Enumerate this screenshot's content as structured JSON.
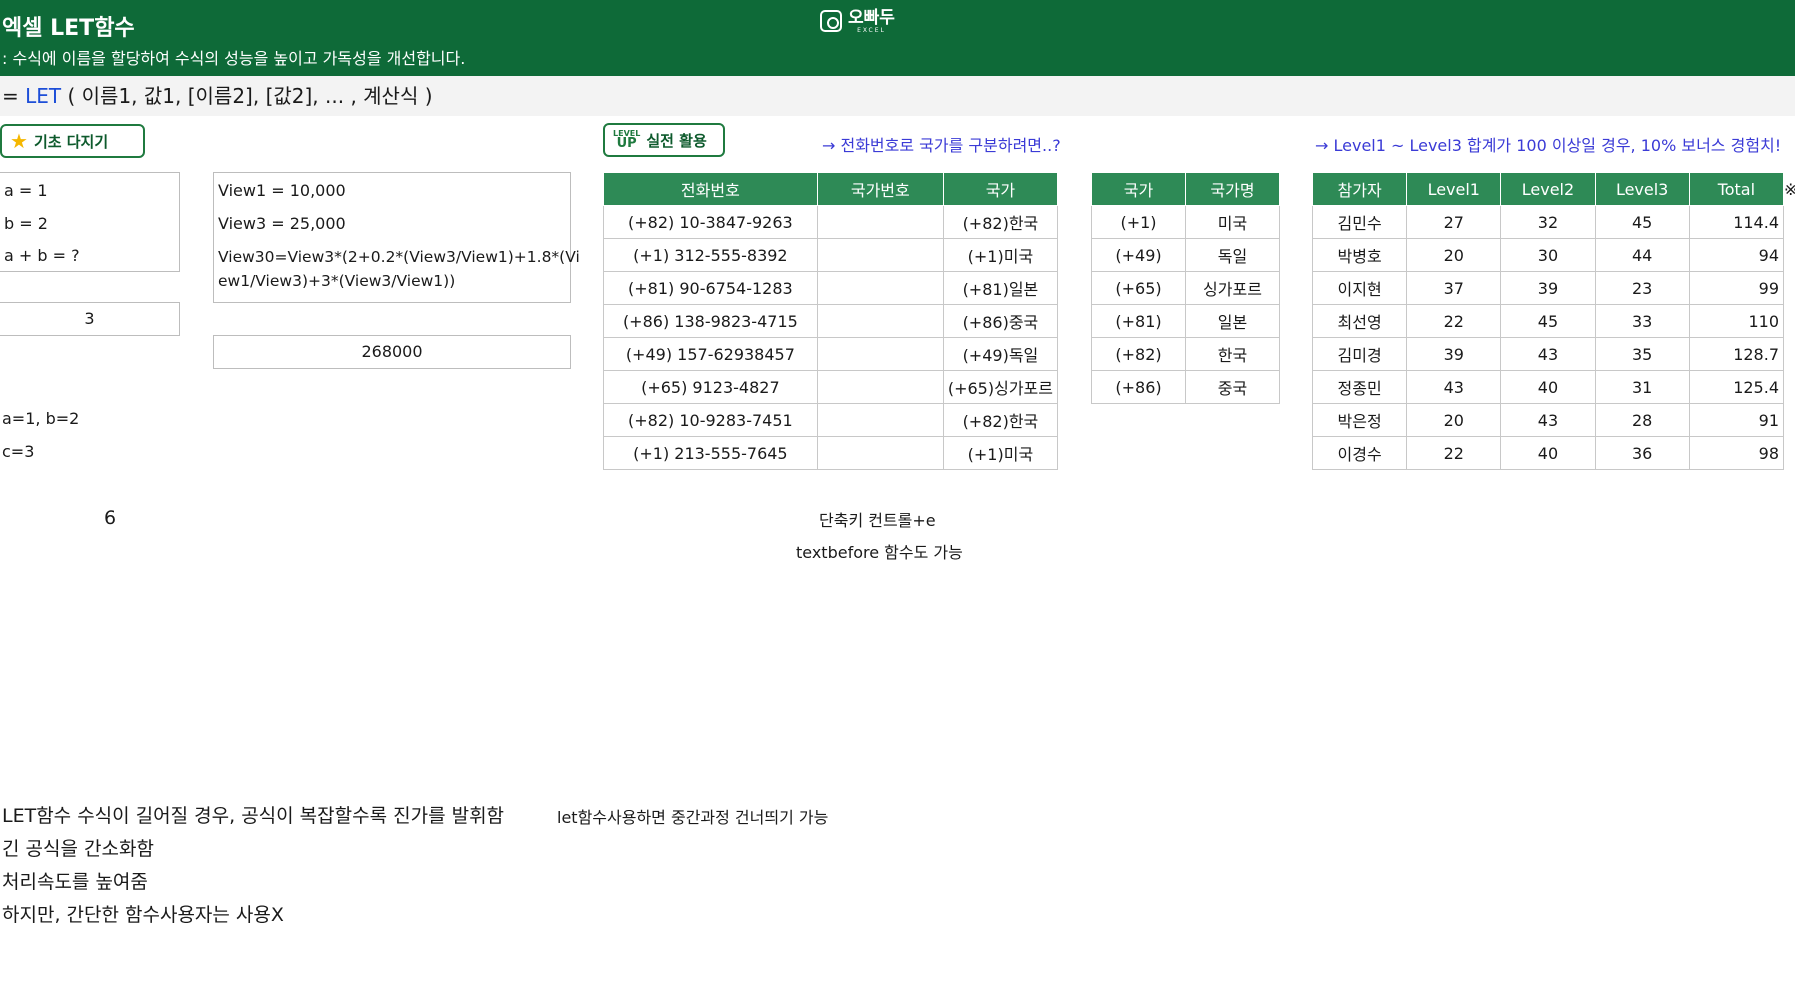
{
  "banner": {
    "title": "엑셀 LET함수",
    "description": ": 수식에 이름을 할당하여 수식의 성능을 높이고 가독성을 개선합니다.",
    "logo_text": "오빠두",
    "logo_sub": "EXCEL"
  },
  "syntax": {
    "prefix": "= ",
    "keyword": "LET",
    "rest": " ( 이름1, 값1, [이름2], [값2], ... , 계산식 )"
  },
  "badges": {
    "basic": "기초 다지기",
    "practical": "실전 활용",
    "level_small": "LEVEL",
    "level_big": "UP"
  },
  "notes": {
    "phone": "→ 전화번호로 국가를 구분하려면..?",
    "bonus": "→ Level1 ~ Level3 합계가 100 이상일 경우, 10% 보너스 경험치!",
    "bonus_mark": "※"
  },
  "basic_example": {
    "lines": [
      "a = 1",
      "b = 2",
      "a +  b = ?"
    ],
    "result": "3",
    "named": "a=1, b=2",
    "c": "c=3",
    "six": "6"
  },
  "view_example": {
    "lines": [
      "View1 = 10,000",
      "View3 = 25,000",
      "View30=View3*(2+0.2*(View3/View1)+1.8*(Vi",
      "ew1/View3)+3*(View3/View1))"
    ],
    "result": "268000"
  },
  "phone_table": {
    "headers": [
      "전화번호",
      "국가번호",
      "국가"
    ],
    "rows": [
      [
        "(+82) 10-3847-9263",
        "",
        "(+82)한국"
      ],
      [
        "(+1) 312-555-8392",
        "",
        "(+1)미국"
      ],
      [
        "(+81) 90-6754-1283",
        "",
        "(+81)일본"
      ],
      [
        "(+86) 138-9823-4715",
        "",
        "(+86)중국"
      ],
      [
        "(+49) 157-62938457",
        "",
        "(+49)독일"
      ],
      [
        "(+65) 9123-4827",
        "",
        "(+65)싱가포르"
      ],
      [
        "(+82) 10-9283-7451",
        "",
        "(+82)한국"
      ],
      [
        "(+1) 213-555-7645",
        "",
        "(+1)미국"
      ]
    ]
  },
  "country_table": {
    "headers": [
      "국가",
      "국가명"
    ],
    "rows": [
      [
        "(+1)",
        "미국"
      ],
      [
        "(+49)",
        "독일"
      ],
      [
        "(+65)",
        "싱가포르"
      ],
      [
        "(+81)",
        "일본"
      ],
      [
        "(+82)",
        "한국"
      ],
      [
        "(+86)",
        "중국"
      ]
    ]
  },
  "level_table": {
    "headers": [
      "참가자",
      "Level1",
      "Level2",
      "Level3",
      "Total"
    ],
    "rows": [
      [
        "김민수",
        "27",
        "32",
        "45",
        "114.4"
      ],
      [
        "박병호",
        "20",
        "30",
        "44",
        "94"
      ],
      [
        "이지현",
        "37",
        "39",
        "23",
        "99"
      ],
      [
        "최선영",
        "22",
        "45",
        "33",
        "110"
      ],
      [
        "김미경",
        "39",
        "43",
        "35",
        "128.7"
      ],
      [
        "정종민",
        "43",
        "40",
        "31",
        "125.4"
      ],
      [
        "박은정",
        "20",
        "43",
        "28",
        "91"
      ],
      [
        "이경수",
        "22",
        "40",
        "36",
        "98"
      ]
    ]
  },
  "tips": {
    "shortcut": "단축키 컨트롤+e",
    "textbefore": "textbefore 함수도 가능"
  },
  "summary": {
    "line1": "LET함수 수식이 길어질 경우, 공식이 복잡할수록 진가를 발휘함",
    "line1_side": "let함수사용하면 중간과정 건너띄기 가능",
    "line2": "긴 공식을 간소화함",
    "line3": "처리속도를 높여줌",
    "line4": "하지만, 간단한 함수사용자는 사용X"
  }
}
